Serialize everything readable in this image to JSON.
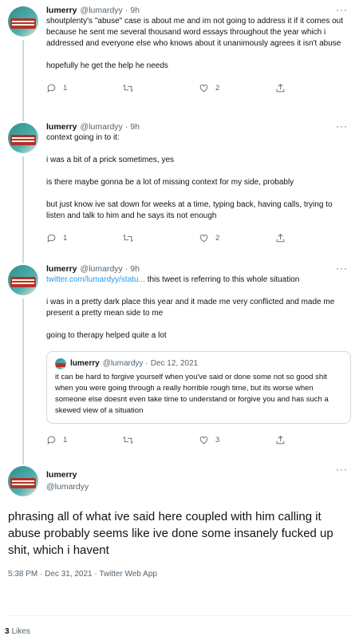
{
  "tweets": [
    {
      "name": "lumerry",
      "handle": "@lumardyy",
      "time": "9h",
      "paragraphs": [
        "shoutplenty's \"abuse\" case is about me and im not going to address it if it comes out because he sent me several thousand word essays throughout the year which i addressed and everyone else who knows about it unanimously agrees it isn't abuse",
        "hopefully he get the help he needs"
      ],
      "replies": "1",
      "retweets": "",
      "likes": "2"
    },
    {
      "name": "lumerry",
      "handle": "@lumardyy",
      "time": "9h",
      "paragraphs": [
        "context going in to it:",
        "i was a bit of a prick sometimes, yes",
        "is there maybe gonna be a lot of missing context for my side, probably",
        "but just know ive sat down for weeks at a time, typing back, having calls, trying to listen and talk to him and he says its not enough"
      ],
      "replies": "1",
      "retweets": "",
      "likes": "2"
    },
    {
      "name": "lumerry",
      "handle": "@lumardyy",
      "time": "9h",
      "link": "twitter.com/lumardyy/statu...",
      "link_suffix": " this tweet is referring to this whole situation",
      "paragraphs": [
        "i was in a pretty dark place this year and it made me very conflicted and made me present a pretty mean side to me",
        "going to therapy helped quite a lot"
      ],
      "quote": {
        "name": "lumerry",
        "handle": "@lumardyy",
        "date": "Dec 12, 2021",
        "text": "it can be hard to forgive yourself when you've said or done some not so good shit when you were going through a really horrible rough time, but its worse when someone else doesnt even take time to understand or forgive you and has such a skewed view of a situation"
      },
      "replies": "1",
      "retweets": "",
      "likes": "3"
    }
  ],
  "main": {
    "name": "lumerry",
    "handle": "@lumardyy",
    "text": "phrasing all of what ive said here coupled with him calling it abuse probably seems like ive done some insanely fucked up shit, which i havent",
    "meta": "5:38 PM · Dec 31, 2021 · Twitter Web App",
    "likes_count": "3",
    "likes_label": "Likes"
  },
  "ui": {
    "dot": "·",
    "more": "···"
  },
  "colors": {
    "link": "#1d9bf0",
    "secondary": "#536471",
    "border": "#cfd9de"
  }
}
